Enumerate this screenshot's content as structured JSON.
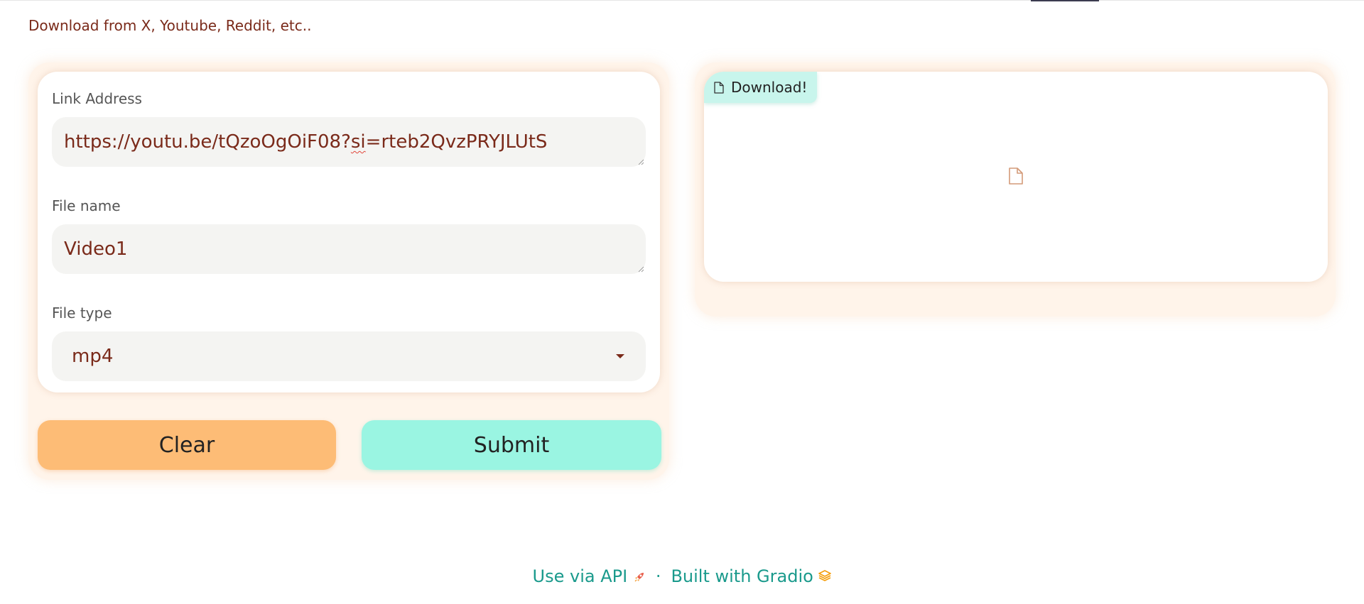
{
  "description": "Download from X, Youtube, Reddit, etc..",
  "form": {
    "link": {
      "label": "Link Address",
      "value_before": "https://youtu.be/tQzoOgOiF08?",
      "value_misspelled": "si",
      "value_after": "=rteb2QvzPRYJLUtS"
    },
    "filename": {
      "label": "File name",
      "value": "Video1"
    },
    "filetype": {
      "label": "File type",
      "selected": "mp4"
    }
  },
  "buttons": {
    "clear": "Clear",
    "submit": "Submit"
  },
  "output": {
    "label": "Download!",
    "icon": "file-icon"
  },
  "footer": {
    "api_link": "Use via API",
    "separator": "·",
    "built_with": "Built with Gradio",
    "api_icon": "rocket-icon",
    "gradio_icon": "gradio-logo-icon"
  },
  "colors": {
    "accent_text": "#7a2a1a",
    "clear_button": "#fdbc76",
    "submit_button": "#9af5e2",
    "footer_link": "#1a9a8c",
    "panel_bg": "#fff4ea"
  }
}
